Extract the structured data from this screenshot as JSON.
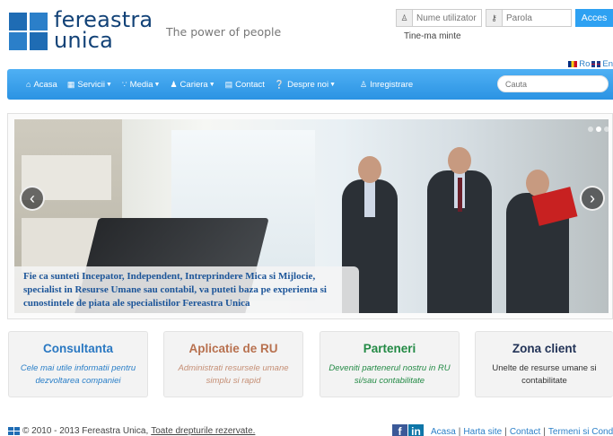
{
  "brand": {
    "logo_line1": "fereastra",
    "logo_line2": "unica",
    "tagline": "The power of people"
  },
  "login": {
    "username_placeholder": "Nume utilizator",
    "password_placeholder": "Parola",
    "submit_label": "Acces",
    "remember_label": "Tine-ma minte"
  },
  "languages": [
    {
      "code": "Ro"
    },
    {
      "code": "En"
    }
  ],
  "nav": {
    "items": [
      {
        "label": "Acasa",
        "icon": "home-icon"
      },
      {
        "label": "Servicii",
        "icon": "grid-icon",
        "dropdown": true
      },
      {
        "label": "Media",
        "icon": "rss-icon",
        "dropdown": true
      },
      {
        "label": "Cariera",
        "icon": "users-icon",
        "dropdown": true
      },
      {
        "label": "Contact",
        "icon": "book-icon"
      },
      {
        "label": "Despre noi",
        "icon": "question-icon",
        "dropdown": true
      }
    ],
    "register_label": "Inregistrare",
    "search_placeholder": "Cauta"
  },
  "slider": {
    "caption": "Fie ca sunteti Incepator, Independent, Intreprindere Mica si Mijlocie, specialist in Resurse Umane sau contabil, va puteti baza pe experienta si cunostintele de piata ale specialistilor Fereastra Unica",
    "slide_count": 3,
    "active_index": 1
  },
  "features": [
    {
      "title": "Consultanta",
      "text": "Cele mai utile informatii pentru dezvoltarea companiei"
    },
    {
      "title": "Aplicatie de RU",
      "text": "Administrati resursele umane simplu si rapid"
    },
    {
      "title": "Parteneri",
      "text": "Deveniti partenerul nostru in RU si/sau contabilitate"
    },
    {
      "title": "Zona client",
      "text": "Unelte de resurse umane si contabilitate"
    }
  ],
  "footer": {
    "copyright": "© 2010 - 2013 Fereastra Unica,",
    "rights": "Toate drepturile rezervate.",
    "links": [
      "Acasa",
      "Harta site",
      "Contact",
      "Termeni si Conditii"
    ]
  },
  "colors": {
    "brand_blue": "#124277",
    "nav_blue": "#2b93e3",
    "accent_button": "#2ea1f2"
  }
}
